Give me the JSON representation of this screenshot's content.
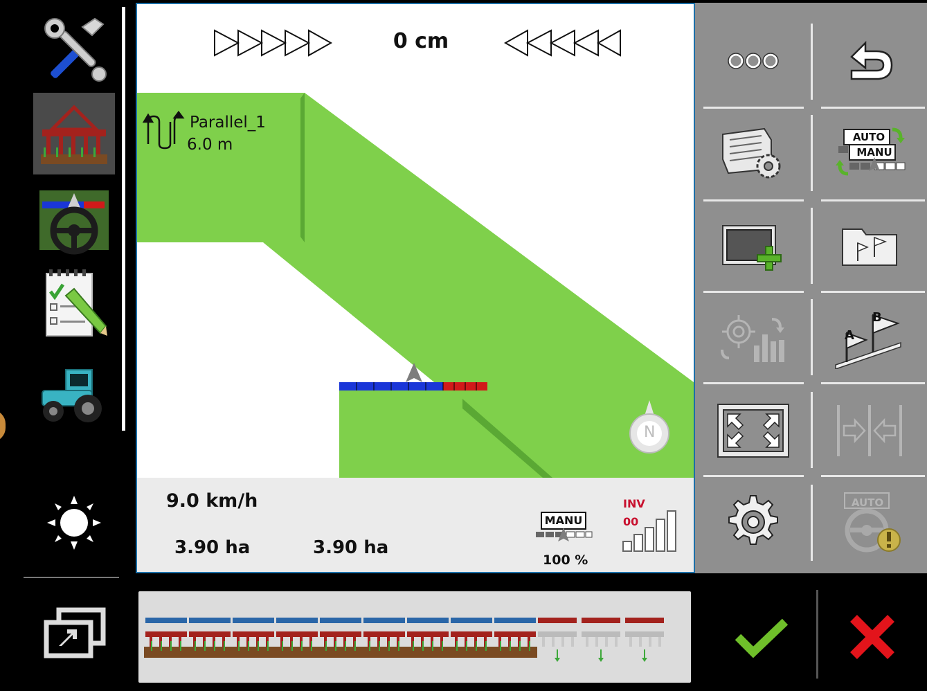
{
  "map": {
    "deviation": "0 cm",
    "guidance": {
      "name": "Parallel_1",
      "width": "6.0 m"
    },
    "compass_letter": "N"
  },
  "info": {
    "speed": "9.0 km/h",
    "area_worked": "3.90 ha",
    "area_total": "3.90 ha",
    "manu_badge": "MANU",
    "manu_percent": "100 %",
    "inv_label": "INV",
    "inv_value": "00"
  },
  "softkeys": {
    "auto_manu_top": "AUTO",
    "auto_manu_bottom": "MANU",
    "auto_disabled": "AUTO",
    "ab_a": "A",
    "ab_b": "B"
  },
  "colors": {
    "field_green": "#7fd04b",
    "section_active": "#1a36d8",
    "section_inactive": "#d11a1a",
    "softkey_bg": "#8f8f8f",
    "confirm": "#6fbf2a",
    "cancel": "#e3141b"
  },
  "icons": {
    "sidebar": [
      "tools-icon",
      "seeder-icon",
      "steering-wheel-icon",
      "checklist-icon",
      "tractor-icon",
      "brightness-icon",
      "window-switch-icon"
    ],
    "softkeys": [
      "more-icon",
      "return-icon",
      "field-settings-icon",
      "auto-manu-icon",
      "add-field-icon",
      "ab-folder-icon",
      "recalibrate-icon",
      "ab-line-icon",
      "zoom-fit-icon",
      "shift-line-icon",
      "settings-gear-icon",
      "auto-steer-warning-icon"
    ]
  }
}
